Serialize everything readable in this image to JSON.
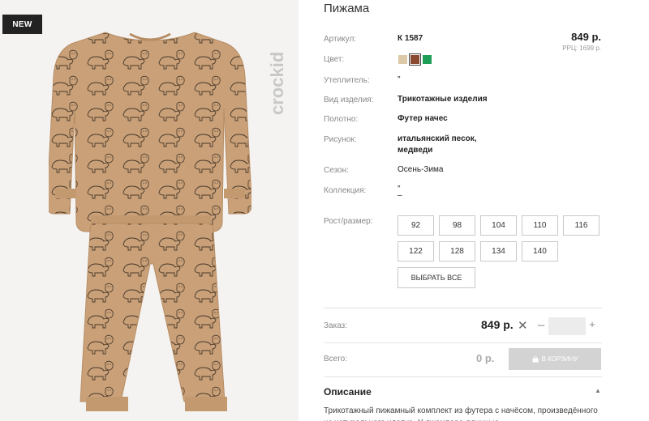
{
  "badge": {
    "label": "NEW"
  },
  "brand": {
    "logo_text": "crockid"
  },
  "product": {
    "title": "Пижама",
    "price": "849 р.",
    "rrp": "РРЦ: 1699 р."
  },
  "specs": [
    {
      "label": "Артикул:",
      "value": "К 1587",
      "bold": true
    },
    {
      "label": "Цвет:",
      "value": ""
    },
    {
      "label": "Утеплитель:",
      "value": "\"",
      "bold": false
    },
    {
      "label": "Вид изделия:",
      "value": "Трикотажные изделия",
      "bold": true
    },
    {
      "label": "Полотно:",
      "value": "Футер начес",
      "bold": true
    },
    {
      "label": "Рисунок:",
      "value": "итальянский песок,",
      "value2": "медведи",
      "bold": true
    },
    {
      "label": "Сезон:",
      "value": "Осень-Зима",
      "bold": false
    },
    {
      "label": "Коллекция:",
      "value": "\"",
      "value2": "–",
      "bold": false
    }
  ],
  "colors": [
    {
      "name": "sand",
      "hex": "#dcc9a7",
      "selected": false
    },
    {
      "name": "brown",
      "hex": "#8a4a32",
      "selected": true
    },
    {
      "name": "green",
      "hex": "#1f9e57",
      "selected": false
    }
  ],
  "sizes": {
    "label": "Рост/размер:",
    "options": [
      "92",
      "98",
      "104",
      "110",
      "116",
      "122",
      "128",
      "134",
      "140"
    ],
    "select_all": "ВЫБРАТЬ ВСЕ"
  },
  "order": {
    "label": "Заказ:",
    "price": "849 р.",
    "times": "✕",
    "minus": "–",
    "plus": "+",
    "quantity": ""
  },
  "total": {
    "label": "Всего:",
    "value": "0 р.",
    "cart_button": "В КОРЗИНУ",
    "cart_icon": "bag-icon"
  },
  "description": {
    "title": "Описание",
    "caret": "▲",
    "text": "Трикотажный пижамный комплект из футера с начёсом, произведённого из натурального хлопка. У джемпера длинные"
  },
  "palette": {
    "fabric": "#c9a078",
    "fabric_shadow": "#b78d64",
    "line": "#4a3a2a"
  }
}
